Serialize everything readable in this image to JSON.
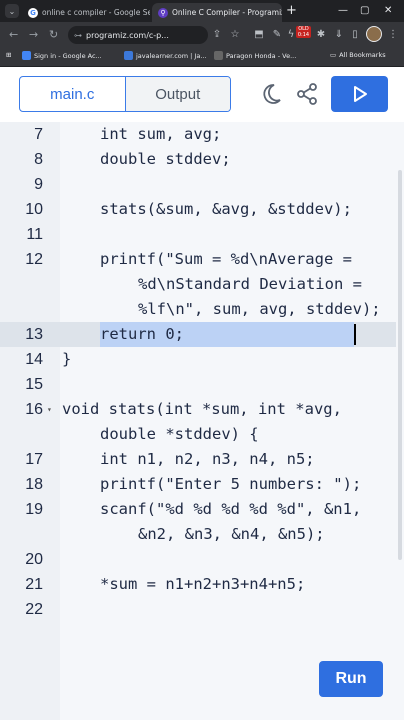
{
  "browser": {
    "tabs": [
      {
        "title": "online c compiler - Google Sea",
        "active": false
      },
      {
        "title": "Online C Compiler - Programiz",
        "active": true
      }
    ],
    "url": "programiz.com/c-p...",
    "badge": "OLD 0:14",
    "bookmarks": [
      {
        "label": "Sign in - Google Ac..."
      },
      {
        "label": "javalearner.com | Ja..."
      },
      {
        "label": "Paragon Honda - Ve..."
      },
      {
        "label": "All Bookmarks"
      }
    ]
  },
  "app": {
    "file_tab": "main.c",
    "output_tab": "Output",
    "run_label": "Run",
    "accent": "#2f6fe0"
  },
  "editor": {
    "lines": [
      {
        "num": "7",
        "indent": 1,
        "text": "int sum, avg;"
      },
      {
        "num": "8",
        "indent": 1,
        "text": "double stddev;"
      },
      {
        "num": "9",
        "indent": 0,
        "text": ""
      },
      {
        "num": "10",
        "indent": 1,
        "text": "stats(&sum, &avg, &stddev);"
      },
      {
        "num": "11",
        "indent": 0,
        "text": ""
      },
      {
        "num": "12",
        "indent": 1,
        "text": "printf(\"Sum = %d\\nAverage ="
      },
      {
        "num": "",
        "indent": 2,
        "text": "%d\\nStandard Deviation ="
      },
      {
        "num": "",
        "indent": 2,
        "text": "%lf\\n\", sum, avg, stddev);"
      },
      {
        "num": "13",
        "indent": 1,
        "text": "return 0;"
      },
      {
        "num": "14",
        "indent": 0,
        "text": "}"
      },
      {
        "num": "15",
        "indent": 0,
        "text": ""
      },
      {
        "num": "16",
        "indent": 0,
        "text": "void stats(int *sum, int *avg,",
        "fold": true
      },
      {
        "num": "",
        "indent": 1,
        "text": "double *stddev) {"
      },
      {
        "num": "17",
        "indent": 1,
        "text": "int n1, n2, n3, n4, n5;"
      },
      {
        "num": "18",
        "indent": 1,
        "text": "printf(\"Enter 5 numbers: \");"
      },
      {
        "num": "19",
        "indent": 1,
        "text": "scanf(\"%d %d %d %d %d\", &n1,"
      },
      {
        "num": "",
        "indent": 2,
        "text": "&n2, &n3, &n4, &n5);"
      },
      {
        "num": "20",
        "indent": 0,
        "text": ""
      },
      {
        "num": "21",
        "indent": 1,
        "text": "*sum = n1+n2+n3+n4+n5;"
      },
      {
        "num": "22",
        "indent": 0,
        "text": ""
      }
    ]
  }
}
